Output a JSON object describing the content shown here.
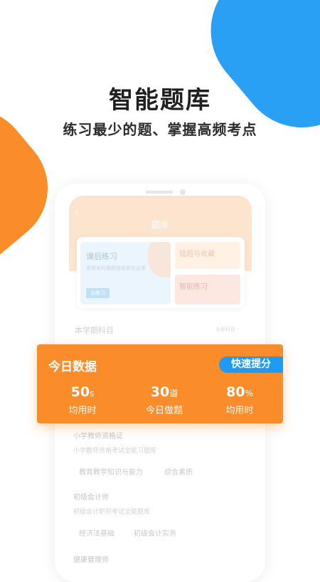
{
  "headline": "智能题库",
  "subline": "练习最少的题、掌握高频考点",
  "phone": {
    "back_icon": "‹",
    "app_title": "题库",
    "card_practice": {
      "title": "课后练习",
      "subtitle": "老师发的做题链接都在这里",
      "button": "去练习"
    },
    "card_errors": "错题与收藏",
    "card_smart": "智能练习",
    "semester_title": "本学期科目",
    "semester_link": "全部科目 ›"
  },
  "panel": {
    "title": "今日数据",
    "quick_button": "快速提分",
    "stats": [
      {
        "value": "50",
        "unit": "s",
        "label": "均用时"
      },
      {
        "value": "30",
        "unit": "道",
        "label": "今日做题"
      },
      {
        "value": "80",
        "unit": "%",
        "label": "均用时"
      }
    ]
  },
  "subjects": [
    {
      "title": "小学教师资格证",
      "subtitle": "小学教师资格考试全能习题库",
      "chips": [
        "教育教学知识与能力",
        "综合素质"
      ]
    },
    {
      "title": "初级会计师",
      "subtitle": "初级会计职称考试全能题库",
      "chips": [
        "经济法基础",
        "初级会计实务"
      ]
    },
    {
      "title": "健康管理师"
    }
  ],
  "colors": {
    "orange": "#fb8c2a",
    "blue": "#2aa0f5",
    "button_blue": "#1e9bf4"
  }
}
